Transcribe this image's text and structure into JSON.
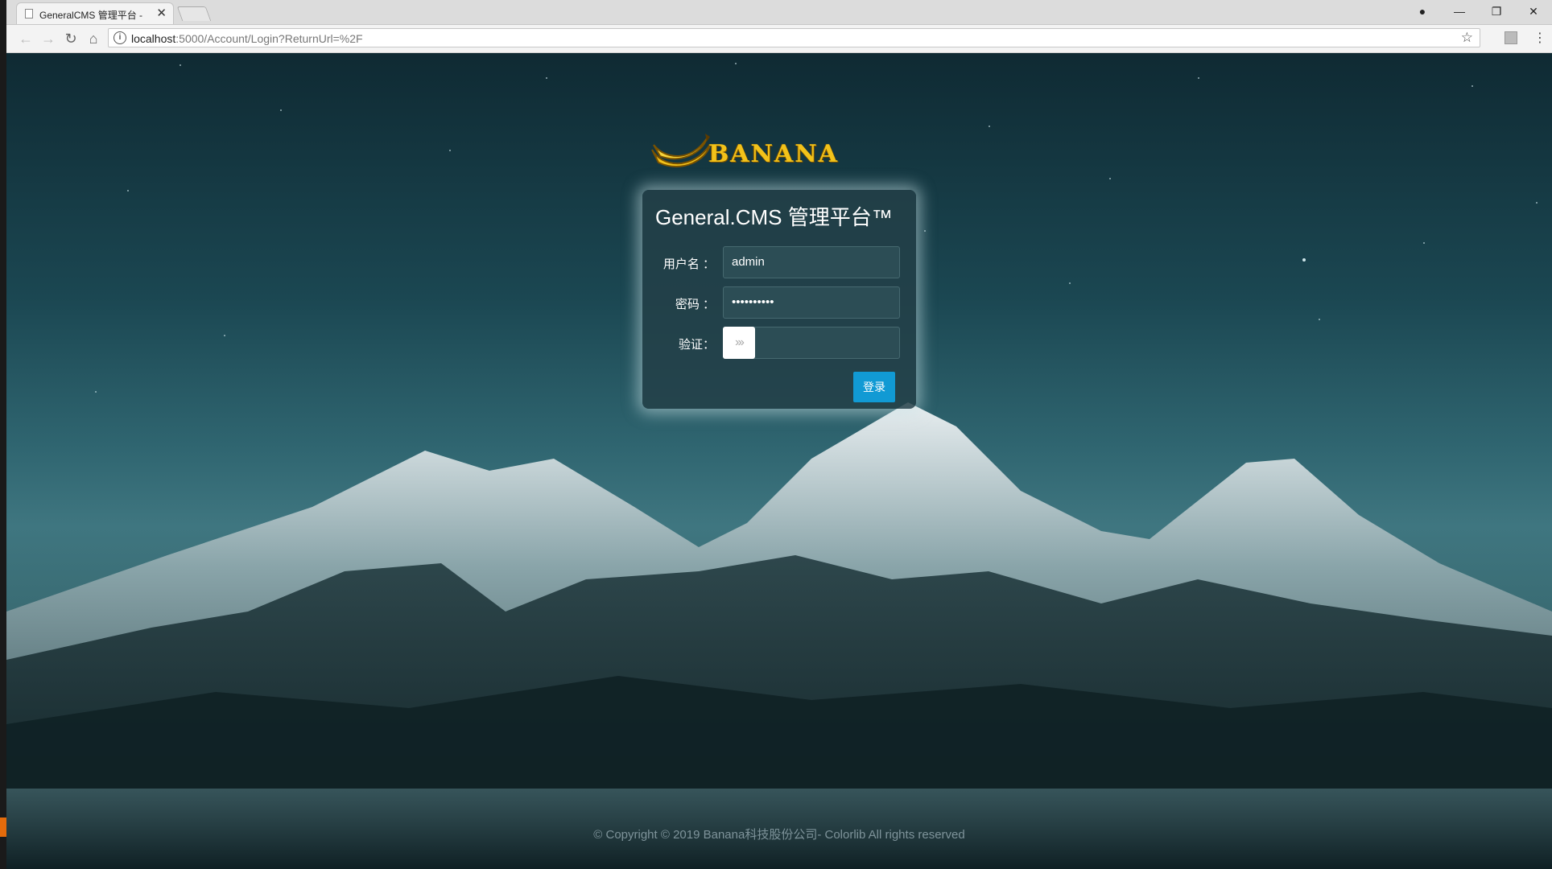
{
  "browser": {
    "tab_title": "GeneralCMS 管理平台 -",
    "url_host": "localhost",
    "url_path": ":5000/Account/Login?ReturnUrl=%2F"
  },
  "logo": {
    "text": "BANANA"
  },
  "login": {
    "title": "General.CMS 管理平台™",
    "username_label": "用户名 ：",
    "username_value": "admin",
    "password_label": "密码 ：",
    "password_value": "••••••••••",
    "verify_label": "验证：",
    "verify_slider_glyph": "›››",
    "submit_label": "登录"
  },
  "footer": {
    "copyright": "© Copyright © 2019 Banana科技股份公司- Colorlib All rights reserved"
  },
  "colors": {
    "accent": "#119ad4",
    "logo_gold": "#f2c21a"
  }
}
